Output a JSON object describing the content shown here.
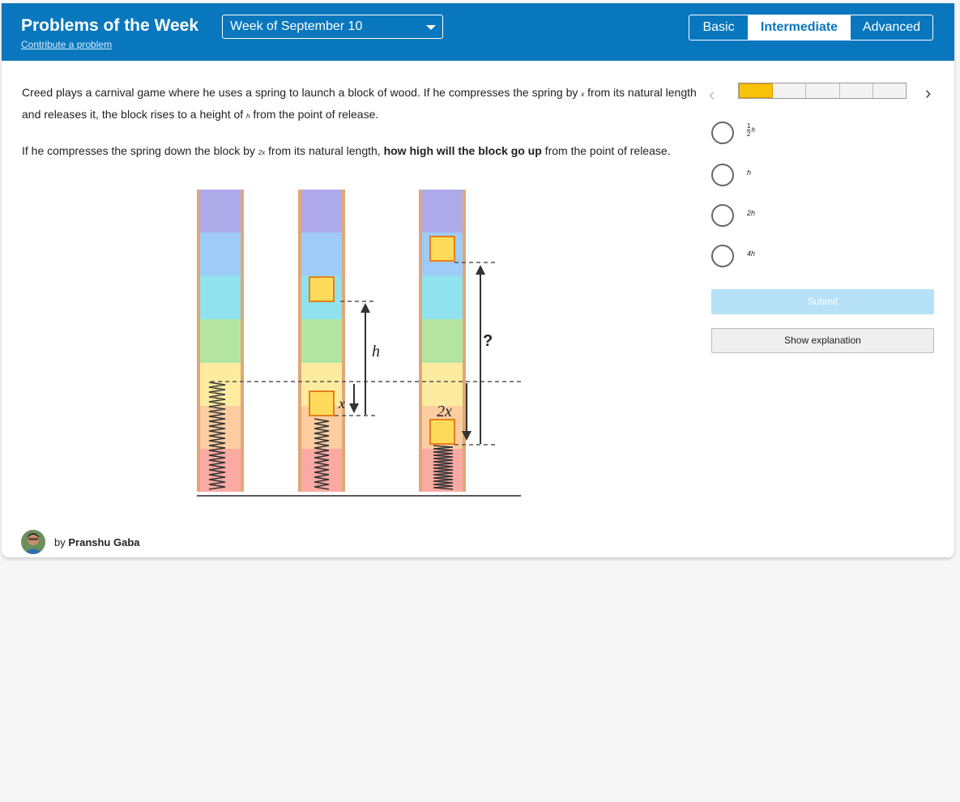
{
  "header": {
    "title": "Problems of the Week",
    "contribute_link": "Contribute a problem",
    "week_select": "Week of September 10",
    "levels": [
      {
        "label": "Basic",
        "selected": false
      },
      {
        "label": "Intermediate",
        "selected": true
      },
      {
        "label": "Advanced",
        "selected": false
      }
    ]
  },
  "problem": {
    "p1_a": "Creed plays a carnival game where he uses a spring to launch a block of wood. If he compresses the spring by ",
    "p1_var_x": "x",
    "p1_b": " from its natural length and releases it, the block rises to a height of ",
    "p1_var_h": "h",
    "p1_c": " from the point of release.",
    "p2_a": "If he compresses the spring down the block by ",
    "p2_var": "2x",
    "p2_b": " from its natural length, ",
    "p2_bold": "how high will the block go up",
    "p2_c": " from the point of release."
  },
  "figure": {
    "label_h": "h",
    "label_x": "x",
    "label_2x": "2x",
    "label_q": "?",
    "stripe_colors": [
      "#aeaaea",
      "#9fcbf9",
      "#8fe2ee",
      "#b3e5a1",
      "#fdec9f",
      "#fbcda0",
      "#fbaaa3"
    ],
    "block_color": "#ffdb5b",
    "block_border": "#e77e19"
  },
  "progress": {
    "segments": 5,
    "active_index": 0
  },
  "navigation": {
    "prev": "‹",
    "next": "›"
  },
  "options": [
    {
      "type": "frac",
      "num": "1",
      "den": "2",
      "var": "h"
    },
    {
      "type": "text",
      "label": "h"
    },
    {
      "type": "text",
      "label": "2h"
    },
    {
      "type": "text",
      "label": "4h"
    }
  ],
  "buttons": {
    "submit": "Submit",
    "explain": "Show explanation"
  },
  "author": {
    "by": "by",
    "name": "Pranshu Gaba"
  },
  "colors": {
    "header_bg": "#0877bd",
    "progress_active": "#f8c10a",
    "submit_bg": "#b7e1f7"
  }
}
